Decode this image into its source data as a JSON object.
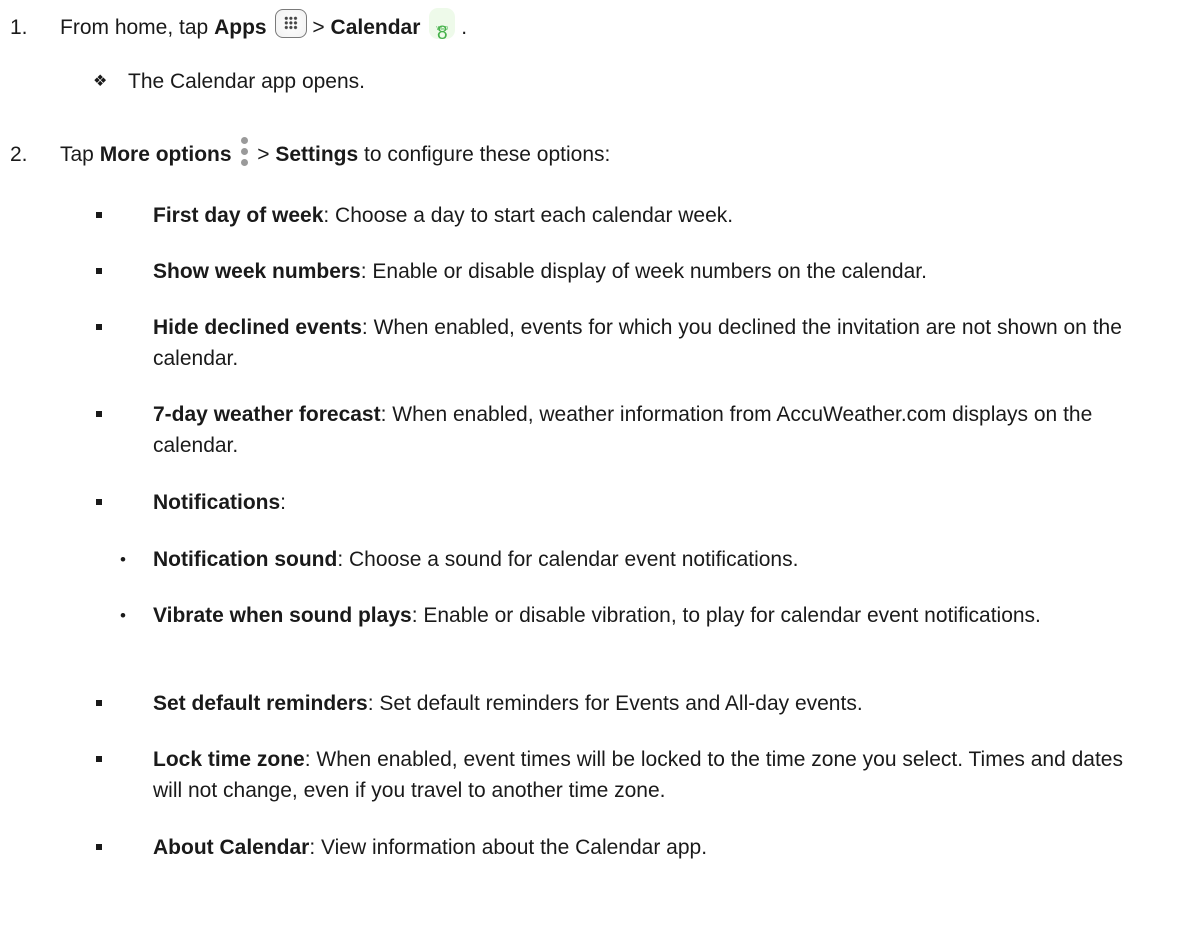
{
  "steps": [
    {
      "number": "1.",
      "parts": {
        "a": "From home, tap",
        "b": "Apps",
        "c": ">",
        "d": "Calendar",
        "e": "."
      },
      "icons": [
        "apps-icon",
        "calendar-app-icon"
      ],
      "calendar_icon": {
        "weekday": "WED",
        "day": "8"
      },
      "result": {
        "marker": "❖",
        "text": "The Calendar app opens."
      }
    },
    {
      "number": "2.",
      "parts": {
        "a": "Tap",
        "b": "More options",
        "c": ">",
        "d": "Settings",
        "e": "to configure these options:"
      },
      "icons": [
        "more-options-icon"
      ]
    }
  ],
  "options": [
    {
      "title": "First day of week",
      "desc": ": Choose a day to start each calendar week."
    },
    {
      "title": "Show week numbers",
      "desc": ": Enable or disable display of week numbers on the calendar."
    },
    {
      "title": "Hide declined events",
      "desc": ": When enabled, events for which you declined the invitation are not shown on the calendar."
    },
    {
      "title": "7-day weather forecast",
      "desc": ": When enabled, weather information from AccuWeather.com displays on the calendar."
    },
    {
      "title": "Notifications",
      "desc": ":"
    },
    {
      "title": "Set default reminders",
      "desc": ": Set default reminders for Events and All-day events."
    },
    {
      "title": "Lock time zone",
      "desc": ": When enabled, event times will be locked to the time zone you select. Times and dates will not change, even if you travel to another time zone."
    },
    {
      "title": "About Calendar",
      "desc": ": View information about the Calendar app."
    }
  ],
  "notification_sub": [
    {
      "marker": "•",
      "title": "Notification sound",
      "desc": ": Choose a sound for calendar event notifications."
    },
    {
      "marker": "•",
      "title": "Vibrate when sound plays",
      "desc": ": Enable or disable vibration, to play for calendar event notifications."
    }
  ],
  "colors": {
    "text": "#1a1a1a",
    "calendar_accent": "#45b14a",
    "icon_border": "#7a7a7a"
  }
}
